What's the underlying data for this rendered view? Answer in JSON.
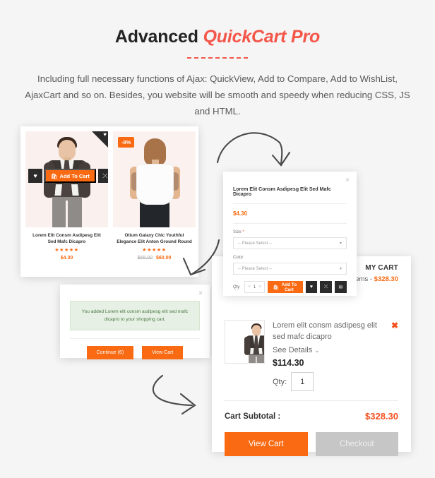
{
  "header": {
    "title_main": "Advanced ",
    "title_accent": "QuickCart Pro",
    "subtitle": "Including full necessary functions of Ajax: QuickView, Add to Compare, Add to WishList, AjaxCart and so on. Besides, you website will be smooth and speedy when reducing CSS, JS and HTML."
  },
  "products": [
    {
      "title": "Lorem Elit Consm Asdipesg Elit Sed Mafc Dicapro",
      "stars": "★★★★★",
      "price": "$4.30",
      "old_price": "",
      "badge": "",
      "wishlist_icon": "heart-icon",
      "hover": {
        "wishlist_icon": "♥",
        "add_to_cart": "Add To Cart",
        "cart_icon": "🛍",
        "compare_icon": "⤫"
      }
    },
    {
      "title": "Otium Galaxy Chic Youthful Elegance Elit Anton Ground Round",
      "stars": "★★★★★",
      "price": "$60.00",
      "old_price": "$65.00",
      "badge": "-8%",
      "wishlist_icon": "",
      "hover": null
    }
  ],
  "ajaxcart": {
    "close_icon": "×",
    "message": "You added Lorem elit consm asdipesg elit sed mafc dicapro to your shopping cart.",
    "continue_label": "Continue (6)",
    "viewcart_label": "View Cart"
  },
  "quickview": {
    "close_icon": "×",
    "title": "Lorem Elit Consm Asdipesg Elit Sed Mafc Dicapro",
    "price": "$4.30",
    "size_label": "Size",
    "size_required": "*",
    "size_value": "-- Please Select --",
    "color_label": "Color",
    "color_value": "-- Please Select --",
    "caret_icon": "▾",
    "qty_label": "Qty",
    "qty_value": "1",
    "qty_down": "˅",
    "qty_up": "˄",
    "add_to_cart": "Add To Cart",
    "cart_icon": "🛍",
    "wishlist_icon": "♥",
    "compare_icon": "⤫",
    "email_icon": "✉"
  },
  "minicart": {
    "title": "MY CART",
    "items_text": "items - ",
    "items_amount": "$328.30",
    "item": {
      "name": "Lorem elit consm asdipesg elit sed mafc dicapro",
      "see_details": "See Details",
      "chevron_icon": "⌄",
      "price": "$114.30",
      "qty_label": "Qty:",
      "qty_value": "1",
      "remove_icon": "✖"
    },
    "subtotal_label": "Cart Subtotal :",
    "subtotal_value": "$328.30",
    "view_cart_label": "View Cart",
    "checkout_label": "Checkout"
  },
  "colors": {
    "accent_orange": "#f96a12",
    "accent_red": "#f4564a",
    "dark": "#2b2b2b",
    "page_bg": "#f5f5f5"
  }
}
